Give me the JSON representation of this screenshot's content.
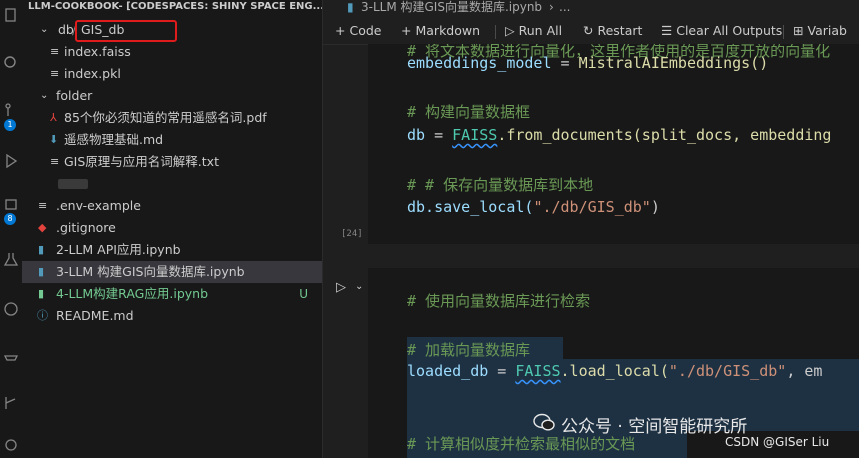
{
  "explorer": {
    "title": "LLM-COOKBOOK- [CODESPACES: SHINY SPACE ENG...",
    "folder_db": "db",
    "folder_gis_db": "GIS_db",
    "files_gis": [
      "index.faiss",
      "index.pkl"
    ],
    "folder_folder": "folder",
    "files_folder": [
      "85个你必须知道的常用遥感名词.pdf",
      "遥感物理基础.md",
      "GIS原理与应用名词解释.txt"
    ],
    "root_files": [
      ".env-example",
      ".gitignore",
      "2-LLM API应用.ipynb",
      "3-LLM 构建GIS向量数据库.ipynb",
      "4-LLM构建RAG应用.ipynb",
      "README.md"
    ],
    "untracked_status": "U"
  },
  "activity_bar": {
    "badges": [
      "1",
      "8"
    ],
    "icons": [
      "explorer-icon",
      "search-icon",
      "source-control-icon",
      "run-debug-icon",
      "remote-explorer-icon",
      "testing-icon",
      "extensions-icon",
      "docker-icon",
      "git-graph-icon"
    ]
  },
  "breadcrumb": {
    "file": "3-LLM 构建GIS向量数据库.ipynb",
    "more": "..."
  },
  "toolbar": {
    "code": "Code",
    "markdown": "Markdown",
    "run_all": "Run All",
    "restart": "Restart",
    "clear_all": "Clear All Outputs",
    "variables": "Variab"
  },
  "cell1": {
    "line_top": "# 将文本数据进行向量化，这里作者使用的是百度开放的向量化",
    "line1_var": "embeddings_model",
    "line1_eq": " = ",
    "line1_call": "MistralAIEmbeddings()",
    "comment2": "# 构建向量数据框",
    "line3_var": "db",
    "line3_eq": " = ",
    "line3_cls": "FAISS",
    "line3_rest": ".from_documents(split_docs, embedding",
    "comment3": "# # 保存向量数据库到本地",
    "line4_a": "db.save_local(",
    "line4_str": "\"./db/GIS_db\"",
    "line4_b": ")",
    "exec_count": "[24]"
  },
  "cell2": {
    "comment1": "# 使用向量数据库进行检索",
    "comment2": "# 加载向量数据库",
    "line2_var": "loaded_db",
    "line2_eq": " = ",
    "line2_cls": "FAISS",
    "line2_rest": ".load_local(",
    "line2_str": "\"./db/GIS_db\"",
    "line2_tail": ", em",
    "comment3": "# 计算相似度并检索最相似的文档"
  },
  "watermark": {
    "main": "公众号 · 空间智能研究所",
    "sub": "CSDN @GISer Liu"
  },
  "colors": {
    "accent": "#0078d4",
    "red_box": "#e01b1b",
    "untracked": "#73c991",
    "comment": "#6a9955"
  }
}
